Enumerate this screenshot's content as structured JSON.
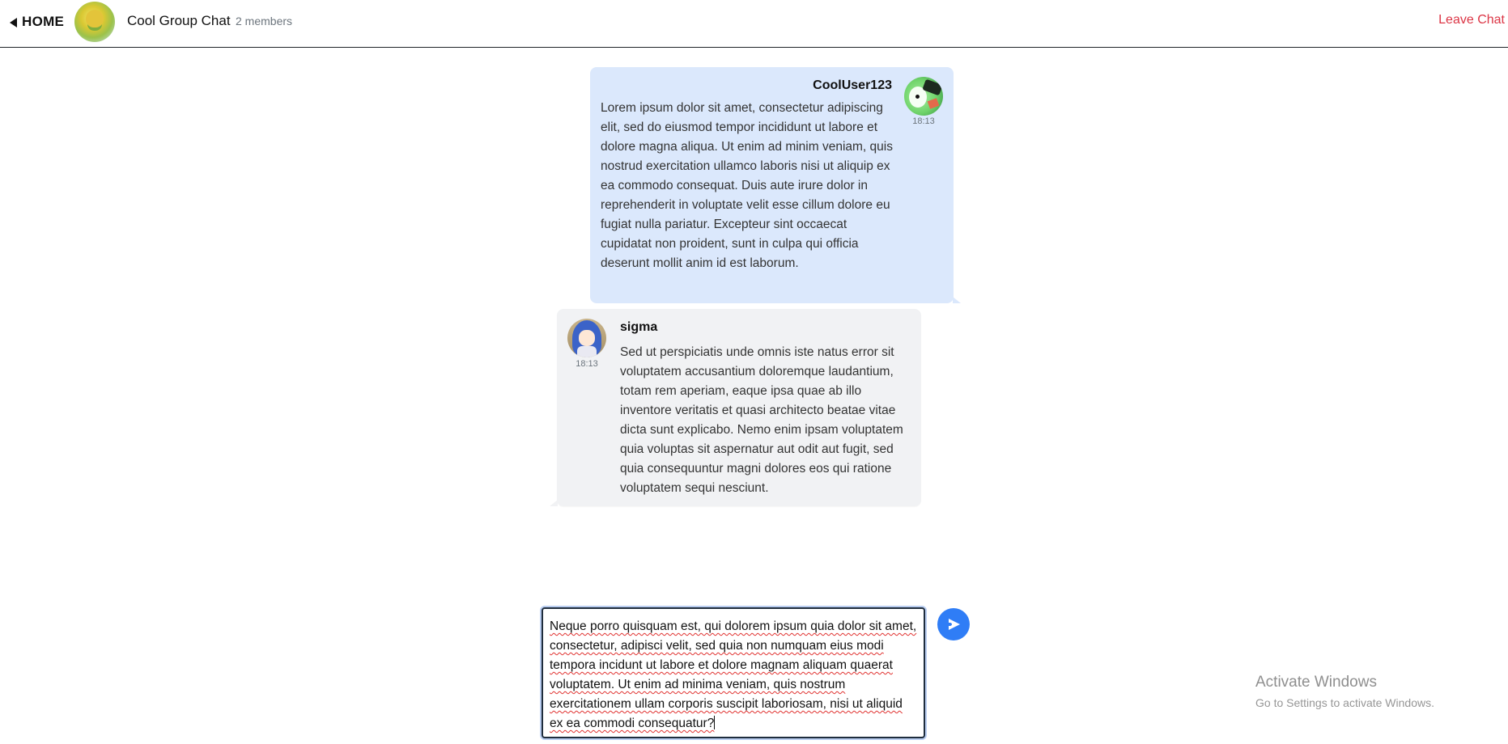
{
  "header": {
    "home_label": "HOME",
    "chat_title": "Cool Group Chat",
    "member_count": "2 members",
    "leave_label": "Leave Chat",
    "back_icon": "chevron-left-icon",
    "leave_color": "#dc3545"
  },
  "messages": [
    {
      "author": "CoolUser123",
      "time": "18:13",
      "own": true,
      "bubble_color": "#dbe8fc",
      "text": "Lorem ipsum dolor sit amet, consectetur adipiscing elit, sed do eiusmod tempor incididunt ut labore et dolore magna aliqua. Ut enim ad minim veniam, quis nostrud exercitation ullamco laboris nisi ut aliquip ex ea commodo consequat. Duis aute irure dolor in reprehenderit in voluptate velit esse cillum dolore eu fugiat nulla pariatur. Excepteur sint occaecat cupidatat non proident, sunt in culpa qui officia deserunt mollit anim id est laborum."
    },
    {
      "author": "sigma",
      "time": "18:13",
      "own": false,
      "bubble_color": "#f1f2f4",
      "text": "Sed ut perspiciatis unde omnis iste natus error sit voluptatem accusantium doloremque laudantium, totam rem aperiam, eaque ipsa quae ab illo inventore veritatis et quasi architecto beatae vitae dicta sunt explicabo. Nemo enim ipsam voluptatem quia voluptas sit aspernatur aut odit aut fugit, sed quia consequuntur magni dolores eos qui ratione voluptatem sequi nesciunt."
    }
  ],
  "composer": {
    "value": "Neque porro quisquam est, qui dolorem ipsum quia dolor sit amet, consectetur, adipisci velit, sed quia non numquam eius modi tempora incidunt ut labore et dolore magnam aliquam quaerat voluptatem. Ut enim ad minima veniam, quis nostrum exercitationem ullam corporis suscipit laboriosam, nisi ut aliquid ex ea commodi consequatur?",
    "send_icon": "send-arrow-icon",
    "send_color": "#2f7df6"
  },
  "watermark": {
    "title": "Activate Windows",
    "subtitle": "Go to Settings to activate Windows."
  }
}
